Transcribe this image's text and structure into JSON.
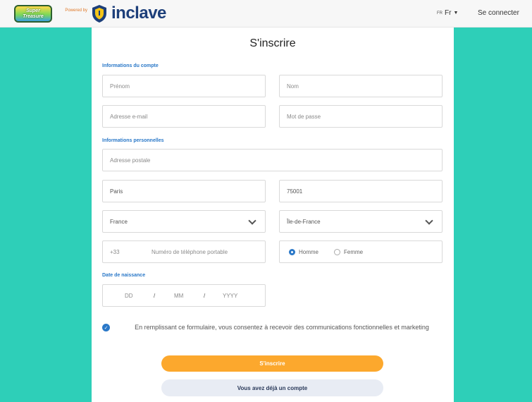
{
  "header": {
    "logo_text": "Super Treasure",
    "powered_by": "Powered by",
    "brand": "inclave",
    "lang_small": "FR",
    "lang": "Fr",
    "login": "Se connecter"
  },
  "form": {
    "title": "S'inscrire",
    "sections": {
      "account": "Informations du compte",
      "personal": "Informations personnelles",
      "birth": "Date de naissance"
    },
    "fields": {
      "firstname": "Prénom",
      "lastname": "Nom",
      "email": "Adresse e-mail",
      "password": "Mot de passe",
      "address": "Adresse postale",
      "city": "Paris",
      "zip": "75001",
      "country": "France",
      "region": "Île-de-France",
      "phone_prefix": "+33",
      "phone": "Numéro de téléphone portable",
      "gender_male": "Homme",
      "gender_female": "Femme",
      "dd": "DD",
      "mm": "MM",
      "yyyy": "YYYY",
      "slash": "/"
    },
    "consent": "En remplissant ce formulaire, vous consentez à recevoir des communications fonctionnelles et marketing",
    "submit": "S'inscrire",
    "have_account": "Vous avez déjà un compte"
  },
  "colors": {
    "accent": "#2a78c8",
    "brand": "#1d3f7a",
    "cta": "#fca82d",
    "background": "#2ecfb8"
  }
}
